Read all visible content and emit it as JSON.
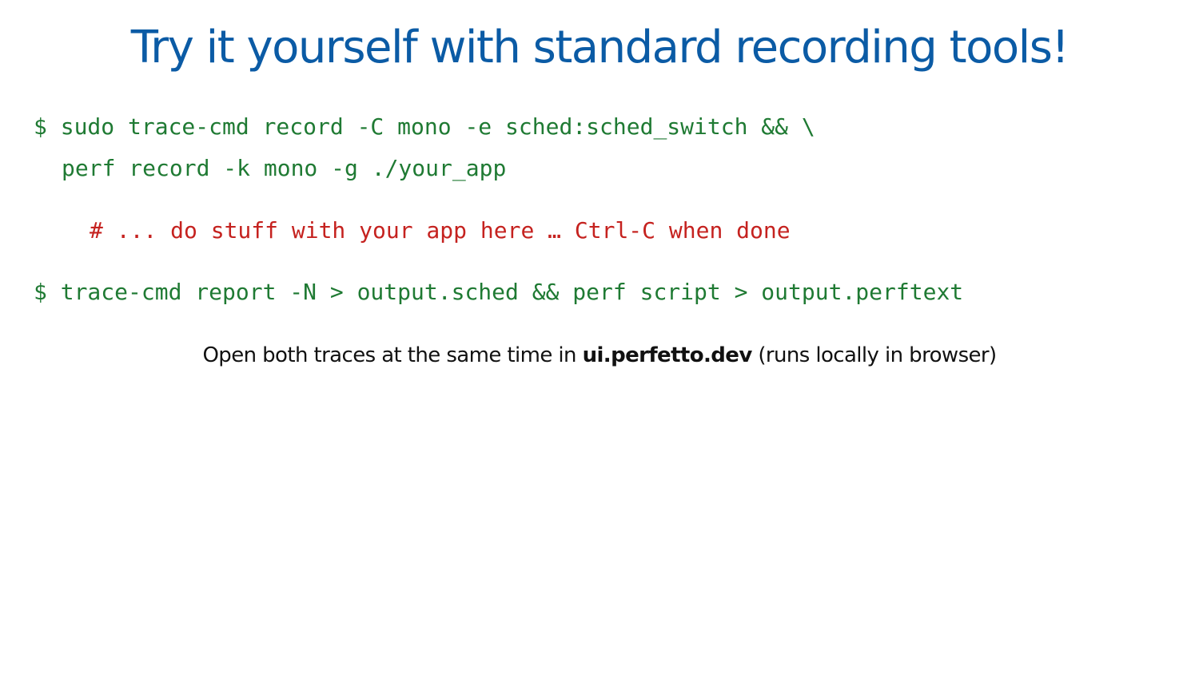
{
  "slide": {
    "title": "Try it yourself with standard recording tools!",
    "commands": {
      "line1": "$ sudo trace-cmd record -C mono -e sched:sched_switch && \\",
      "line2": "perf record -k mono -g ./your_app",
      "comment": "# ... do stuff with your app here … Ctrl-C when done",
      "line4": "$ trace-cmd report -N > output.sched && perf script > output.perftext"
    },
    "caption": {
      "before": "Open both traces at the same time in ",
      "link": "ui.perfetto.dev",
      "after": " (runs locally in browser)"
    }
  },
  "colors": {
    "title": "#0b5ba5",
    "command": "#1f7a33",
    "comment": "#c5221f",
    "caption": "#111111"
  }
}
